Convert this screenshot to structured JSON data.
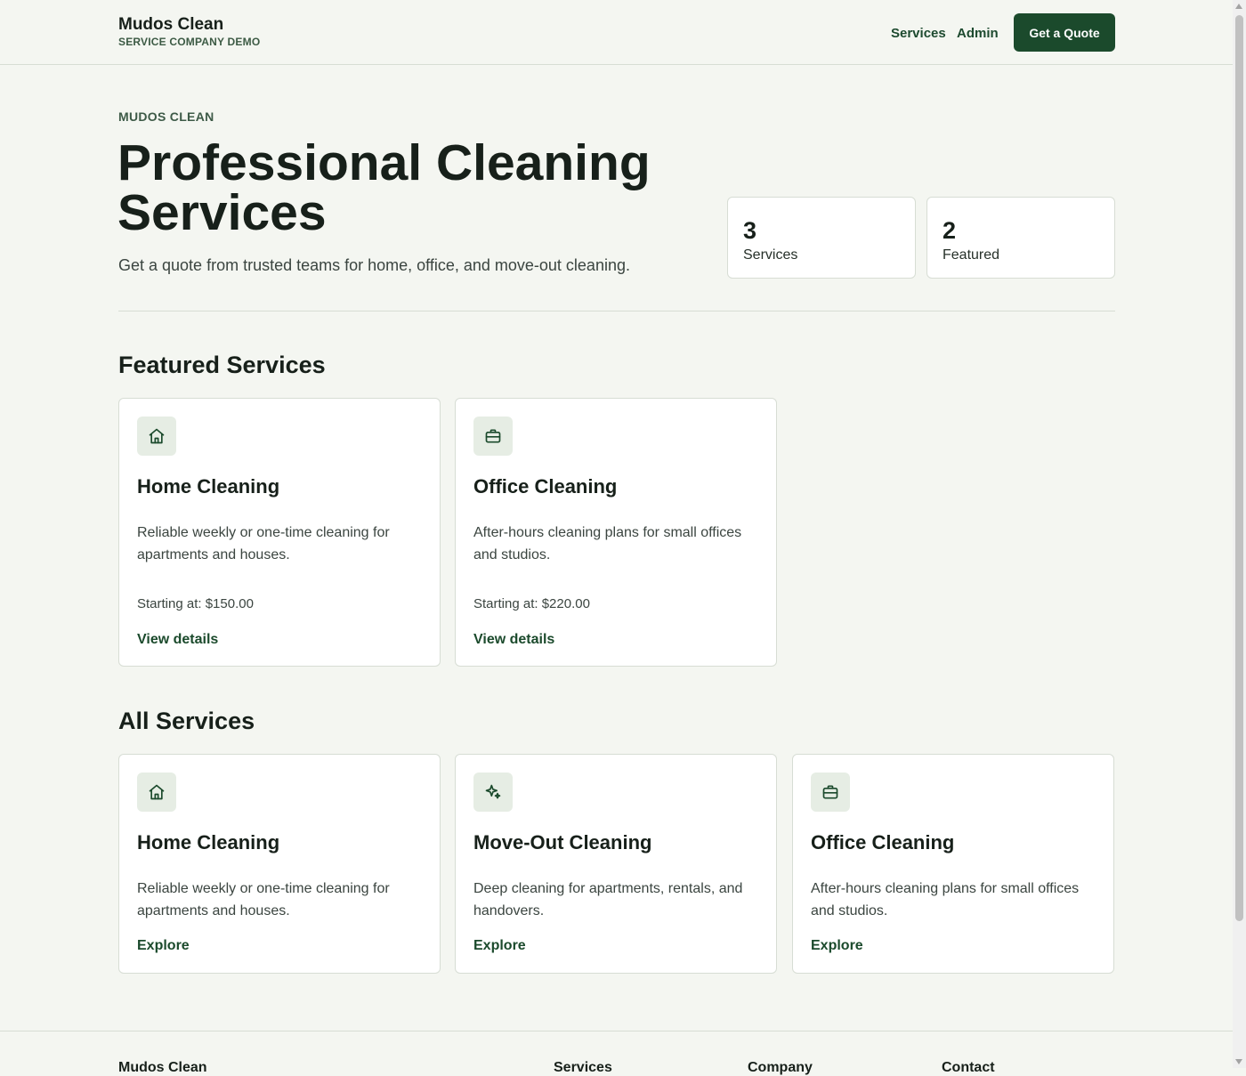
{
  "header": {
    "brand": "Mudos Clean",
    "brand_sub": "SERVICE COMPANY DEMO",
    "nav": [
      "Services",
      "Admin"
    ],
    "cta": "Get a Quote"
  },
  "hero": {
    "eyebrow": "MUDOS CLEAN",
    "title": "Professional Cleaning Services",
    "subtitle": "Get a quote from trusted teams for home, office, and move-out cleaning.",
    "stats": [
      {
        "value": "3",
        "label": "Services"
      },
      {
        "value": "2",
        "label": "Featured"
      }
    ]
  },
  "featured": {
    "title": "Featured Services",
    "cards": [
      {
        "icon": "home-icon",
        "title": "Home Cleaning",
        "desc": "Reliable weekly or one-time cleaning for apartments and houses.",
        "price": "Starting at: $150.00",
        "link": "View details"
      },
      {
        "icon": "briefcase-icon",
        "title": "Office Cleaning",
        "desc": "After-hours cleaning plans for small offices and studios.",
        "price": "Starting at: $220.00",
        "link": "View details"
      }
    ]
  },
  "all_services": {
    "title": "All Services",
    "cards": [
      {
        "icon": "home-icon",
        "title": "Home Cleaning",
        "desc": "Reliable weekly or one-time cleaning for apartments and houses.",
        "link": "Explore"
      },
      {
        "icon": "sparkles-icon",
        "title": "Move-Out Cleaning",
        "desc": "Deep cleaning for apartments, rentals, and handovers.",
        "link": "Explore"
      },
      {
        "icon": "briefcase-icon",
        "title": "Office Cleaning",
        "desc": "After-hours cleaning plans for small offices and studios.",
        "link": "Explore"
      }
    ]
  },
  "footer": {
    "columns": [
      "Mudos Clean",
      "Services",
      "Company",
      "Contact"
    ]
  },
  "colors": {
    "background": "#f4f6f1",
    "accent": "#1b4a2c",
    "icon_tile": "#e6ede4"
  }
}
